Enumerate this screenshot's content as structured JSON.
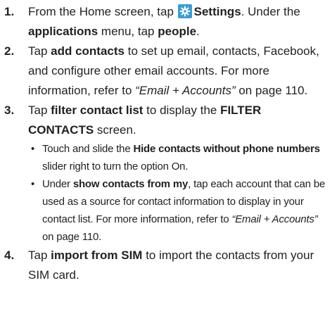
{
  "steps": [
    {
      "num": "1.",
      "t1": "From the Home screen, tap ",
      "settings": "Settings",
      "t2": ". Under the ",
      "applications": "applications",
      "t3": " menu, tap ",
      "people": "people",
      "t4": "."
    },
    {
      "num": "2.",
      "t1": "Tap ",
      "add_contacts": "add contacts",
      "t2": " to set up email, contacts, Facebook, and configure other email accounts. For more information, refer to ",
      "ref": "“Email + Accounts”",
      "t3": " on page 110."
    },
    {
      "num": "3.",
      "t1": "Tap ",
      "filter": "filter contact list",
      "t2": " to display the ",
      "screen": "FILTER CONTACTS",
      "t3": " screen.",
      "bullets": [
        {
          "t1": "Touch and slide the ",
          "bold": "Hide contacts without phone numbers",
          "t2": " slider right to turn the option On."
        },
        {
          "t1": "Under ",
          "bold": "show contacts from my",
          "t2": ", tap each account that can be used as a source for contact information to display in your contact list. For more information, refer to ",
          "ref": "“Email + Accounts”",
          "t3": " on page 110."
        }
      ]
    },
    {
      "num": "4.",
      "t1": "Tap ",
      "import": "import from SIM",
      "t2": " to import the contacts from your SIM card."
    }
  ],
  "icons": {
    "settings": "gear-icon"
  },
  "colors": {
    "settings_icon_bg": "#3a9ed6"
  }
}
